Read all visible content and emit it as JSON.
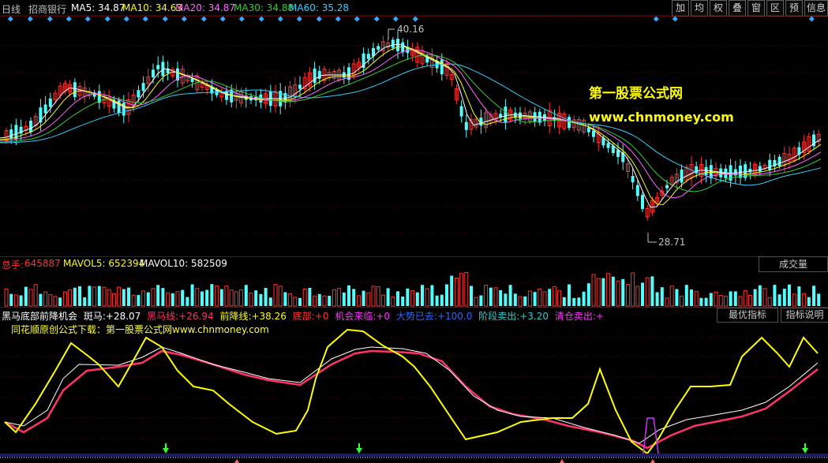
{
  "header": {
    "period": "日线",
    "stock_name": "招商银行",
    "ma": [
      {
        "label": "MA5: 34.87",
        "color": "#ffffff"
      },
      {
        "label": "MA10: 34.63",
        "color": "#ffff00"
      },
      {
        "label": "MA20: 34.87",
        "color": "#ff66ff"
      },
      {
        "label": "MA30: 34.88",
        "color": "#33cc33"
      },
      {
        "label": "MA60: 35.28",
        "color": "#33ccff"
      }
    ]
  },
  "toolbar": [
    "加",
    "均",
    "权",
    "叠",
    "窗",
    "区",
    "预",
    "信息"
  ],
  "price_marks": {
    "high": "40.16",
    "low": "28.71"
  },
  "watermark": {
    "line1": "第一股票公式网",
    "line2": "www.chnmoney.com"
  },
  "volume": {
    "total_label": "总手:",
    "total_value": "645887",
    "mavol5": "MAVOL5: 652394",
    "mavol10": "MAVOL10: 582509",
    "button": "成交量"
  },
  "indicator": {
    "name": "黑马底部前降机会",
    "items": [
      {
        "label": "斑马:",
        "value": "+28.07",
        "color": "#ffffff"
      },
      {
        "label": "黑马线:",
        "value": "+26.94",
        "color": "#ff3366"
      },
      {
        "label": "前降线:",
        "value": "+38.26",
        "color": "#ffff00"
      },
      {
        "label": "底部:",
        "value": "+0",
        "color": "#ff3333"
      },
      {
        "label": "机会来临:",
        "value": "+0",
        "color": "#ff33ff"
      },
      {
        "label": "大势已去:",
        "value": "+100.0",
        "color": "#3366ff"
      },
      {
        "label": "阶段卖出:",
        "value": "+3.20",
        "color": "#33cccc"
      },
      {
        "label": "清仓卖出:",
        "value": "+",
        "color": "#ff33ff"
      }
    ],
    "btn_best": "最优指标",
    "btn_help": "指标说明",
    "subtitle": "同花顺原创公式下载：第一股票公式网www.chnmoney.com"
  },
  "colors": {
    "up": "#ff3232",
    "down": "#54fcfc",
    "border": "#8b0000",
    "accent": "#ffff00"
  }
}
